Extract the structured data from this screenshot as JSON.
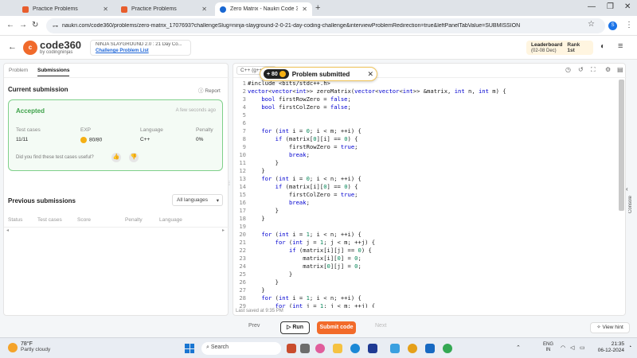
{
  "browser": {
    "tabs": [
      {
        "title": "Practice Problems",
        "active": false
      },
      {
        "title": "Practice Problems",
        "active": false
      },
      {
        "title": "Zero Matrix - Naukri Code 360",
        "active": true
      }
    ],
    "url": "naukri.com/code360/problems/zero-matrix_1707693?challengeSlug=ninja-slayground-2-0-21-day-coding-challenge&interviewProblemRedirection=true&leftPanelTabValue=SUBMISSION",
    "profile_initial": "S"
  },
  "header": {
    "logo_text": "code360",
    "logo_sub": "by codingninjas",
    "challenge_title": "NINJA SLAYGROUND 2.0 : 21 Day Co...",
    "challenge_link": "Challenge Problem List",
    "leaderboard_label": "Leaderboard",
    "leaderboard_dates": "(02-08 Dec)",
    "rank": "Rank 1st"
  },
  "left": {
    "tabs": [
      "Problem",
      "Submissions"
    ],
    "current_submission": "Current submission",
    "report": "Report",
    "status": "Accepted",
    "time_ago": "A few seconds ago",
    "stats": [
      {
        "label": "Test cases",
        "value": "11/11"
      },
      {
        "label": "EXP",
        "value": "80/80"
      },
      {
        "label": "Language",
        "value": "C++"
      },
      {
        "label": "Penalty",
        "value": "0%"
      }
    ],
    "feedback": "Did you find these test cases useful?",
    "previous_submissions": "Previous submissions",
    "language_filter": "All languages",
    "columns": [
      "Status",
      "Test cases",
      "Score",
      "Penalty",
      "Language"
    ]
  },
  "editor": {
    "language": "C++ (g++ 5.4)",
    "lines": [
      "#include <bits/stdc++.h>",
      "vector<vector<int>> zeroMatrix(vector<vector<int>> &matrix, int n, int m) {",
      "    bool firstRowZero = false;",
      "    bool firstColZero = false;",
      "",
      "",
      "    for (int i = 0; i < m; ++i) {",
      "        if (matrix[0][i] == 0) {",
      "            firstRowZero = true;",
      "            break;",
      "        }",
      "    }",
      "    for (int i = 0; i < n; ++i) {",
      "        if (matrix[i][0] == 0) {",
      "            firstColZero = true;",
      "            break;",
      "        }",
      "    }",
      "",
      "    for (int i = 1; i < n; ++i) {",
      "        for (int j = 1; j < m; ++j) {",
      "            if (matrix[i][j] == 0) {",
      "                matrix[i][0] = 0;",
      "                matrix[0][j] = 0;",
      "            }",
      "        }",
      "    }",
      "    for (int i = 1; i < n; ++i) {",
      "        for (int j = 1; j < m; ++j) {"
    ],
    "last_saved": "Last saved at 9:35 PM",
    "console_label": "Console"
  },
  "toast": {
    "points": "+ 80",
    "message": "Problem submitted"
  },
  "footer": {
    "prev": "Prev",
    "run": "Run",
    "submit": "Submit code",
    "next": "Next",
    "hint": "View hint"
  },
  "taskbar": {
    "temp": "78°F",
    "weather": "Partly cloudy",
    "search": "Search",
    "lang": "ENG",
    "region": "IN",
    "time": "21:35",
    "date": "06-12-2024"
  },
  "colors": {
    "accent": "#f26b2a",
    "accepted": "#3ea24a"
  }
}
